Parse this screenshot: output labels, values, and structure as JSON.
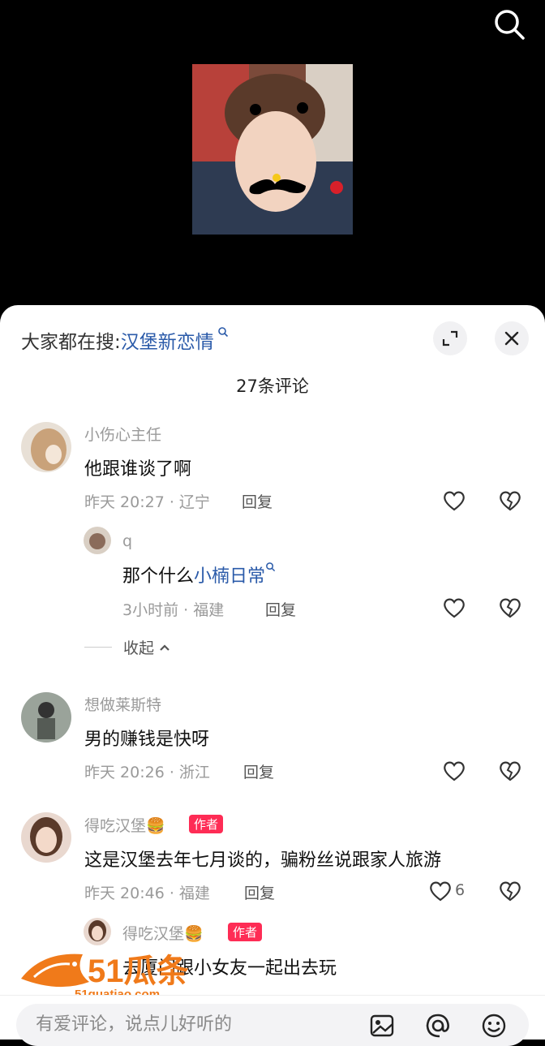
{
  "trending": {
    "prefix": "大家都在搜:",
    "keyword": "汉堡新恋情"
  },
  "comment_count": "27条评论",
  "comments": [
    {
      "name": "小伤心主任",
      "text": "他跟谁谈了啊",
      "meta": "昨天 20:27 · 辽宁",
      "reply_label": "回复",
      "avatar_color": "#c9a27a"
    },
    {
      "name": "q",
      "text_prefix": "那个什么",
      "text_link": "小楠日常",
      "meta": "3小时前 · 福建",
      "reply_label": "回复",
      "avatar_color": "#8a6b5a"
    },
    {
      "name": "想做莱斯特",
      "text": "男的赚钱是快呀",
      "meta": "昨天 20:26 · 浙江",
      "reply_label": "回复",
      "avatar_color": "#555b55"
    },
    {
      "name": "得吃汉堡🍔",
      "badge": "作者",
      "text": "这是汉堡去年七月谈的，骗粉丝说跟家人旅游",
      "meta": "昨天 20:46 · 福建",
      "reply_label": "回复",
      "likes": "6",
      "avatar_color": "#b88c7a"
    },
    {
      "name": "得吃汉堡🍔",
      "badge": "作者",
      "text": "去厦门跟小女友一起出去玩",
      "avatar_color": "#b88c7a"
    }
  ],
  "collapse_label": "收起",
  "composer": {
    "placeholder": "有爱评论，说点儿好听的"
  },
  "watermark": {
    "big": "51瓜条",
    "small": "51guatiao.com"
  },
  "colors": {
    "link": "#2a5aa9",
    "badge": "#fe2c55",
    "watermark": "#f07a1a"
  }
}
